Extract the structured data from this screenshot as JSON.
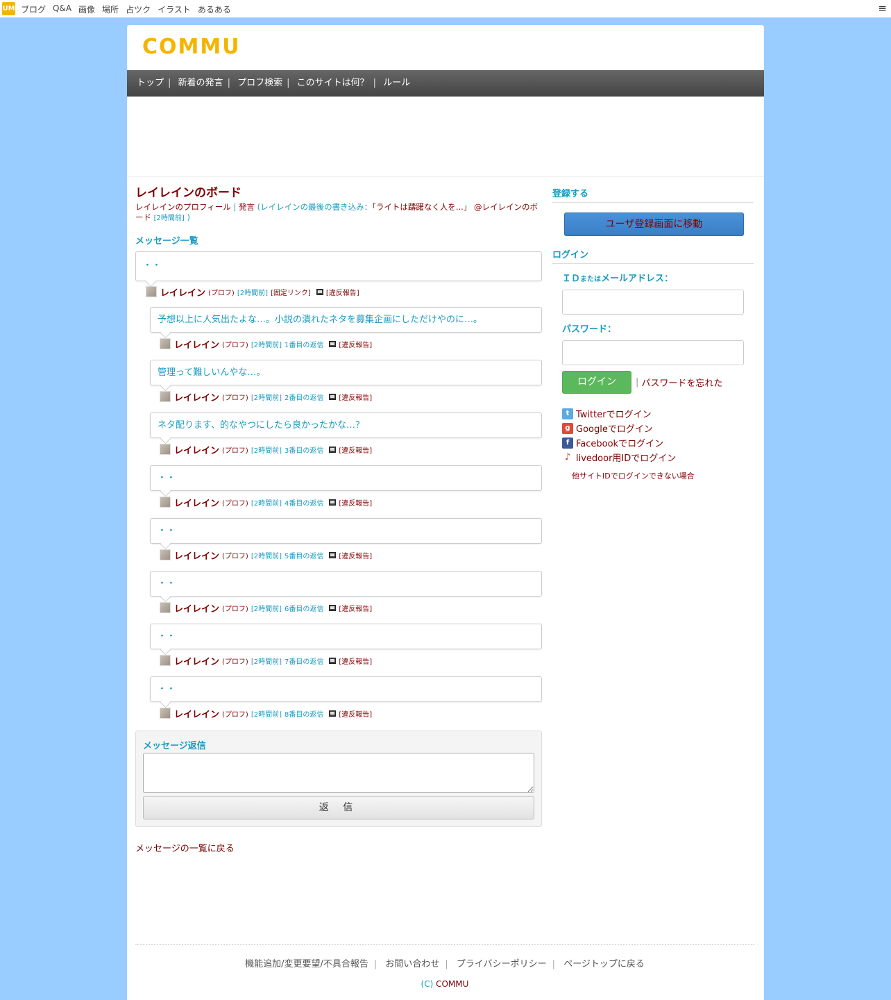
{
  "topbar": {
    "logo": "UM",
    "links": [
      "ブログ",
      "Q&A",
      "画像",
      "場所",
      "占ツク",
      "イラスト",
      "あるある"
    ]
  },
  "site": {
    "logo": "COMMU"
  },
  "gnav": [
    "トップ",
    "新着の発言",
    "プロフ検索",
    "このサイトは何？",
    "ルール"
  ],
  "page": {
    "title": "レイレインのボード",
    "profile_link": "レイレインのプロフィール",
    "sep": " | ",
    "hatsugen": "発言",
    "last_post_open": " (レイレインの最後の書き込み：",
    "last_post_quote": "「ライトは躊躇なく人を...」",
    "last_post_where": " @レイレインのボード",
    "last_post_time": "[2時間前]",
    "last_post_close": " )"
  },
  "messages_title": "メッセージ一覧",
  "first_post": {
    "text": "・・",
    "author": "レイレイン",
    "prof": "(プロフ)",
    "time": "[2時間前]",
    "fixed_link": "[固定リンク]",
    "report": "[違反報告]"
  },
  "replies": [
    {
      "text": "予想以上に人気出たよな…。小説の潰れたネタを募集企画にしただけやのに…。",
      "author": "レイレイン",
      "prof": "(プロフ)",
      "time": "[2時間前]",
      "order": "1番目の返信",
      "report": "[違反報告]"
    },
    {
      "text": "管理って難しいんやな…。",
      "author": "レイレイン",
      "prof": "(プロフ)",
      "time": "[2時間前]",
      "order": "2番目の返信",
      "report": "[違反報告]"
    },
    {
      "text": "ネタ配ります、的なやつにしたら良かったかな…？",
      "author": "レイレイン",
      "prof": "(プロフ)",
      "time": "[2時間前]",
      "order": "3番目の返信",
      "report": "[違反報告]"
    },
    {
      "text": "・・",
      "author": "レイレイン",
      "prof": "(プロフ)",
      "time": "[2時間前]",
      "order": "4番目の返信",
      "report": "[違反報告]"
    },
    {
      "text": "・・",
      "author": "レイレイン",
      "prof": "(プロフ)",
      "time": "[2時間前]",
      "order": "5番目の返信",
      "report": "[違反報告]"
    },
    {
      "text": "・・",
      "author": "レイレイン",
      "prof": "(プロフ)",
      "time": "[2時間前]",
      "order": "6番目の返信",
      "report": "[違反報告]"
    },
    {
      "text": "・・",
      "author": "レイレイン",
      "prof": "(プロフ)",
      "time": "[2時間前]",
      "order": "7番目の返信",
      "report": "[違反報告]"
    },
    {
      "text": "・・",
      "author": "レイレイン",
      "prof": "(プロフ)",
      "time": "[2時間前]",
      "order": "8番目の返信",
      "report": "[違反報告]"
    }
  ],
  "reply_form": {
    "label": "メッセージ返信",
    "textarea_value": "",
    "button": "返 信"
  },
  "back_link": "メッセージの一覧に戻る",
  "sidebar": {
    "register_title": "登録する",
    "register_button": "ユーザ登録画面に移動",
    "login_title": "ログイン",
    "id_label_pre": "ＩＤ",
    "id_label_small": "または",
    "id_label_post": "メールアドレス：",
    "password_label": "パスワード：",
    "login_button": "ログイン",
    "separator": "|",
    "forgot": "パスワードを忘れた",
    "sns": [
      {
        "icon": "twitter-icon",
        "label": "Twitterでログイン"
      },
      {
        "icon": "google-icon",
        "label": "Googleでログイン"
      },
      {
        "icon": "facebook-icon",
        "label": "Facebookでログイン"
      },
      {
        "icon": "livedoor-icon",
        "label": "livedoor用IDでログイン"
      }
    ],
    "other_site": "他サイトIDでログインできない場合"
  },
  "footer": {
    "links": [
      "機能追加/変更要望/不具合報告",
      "お問い合わせ",
      "プライバシーポリシー",
      "ページトップに戻る"
    ],
    "copy_prefix": "(C)",
    "copy_name": "COMMU"
  }
}
